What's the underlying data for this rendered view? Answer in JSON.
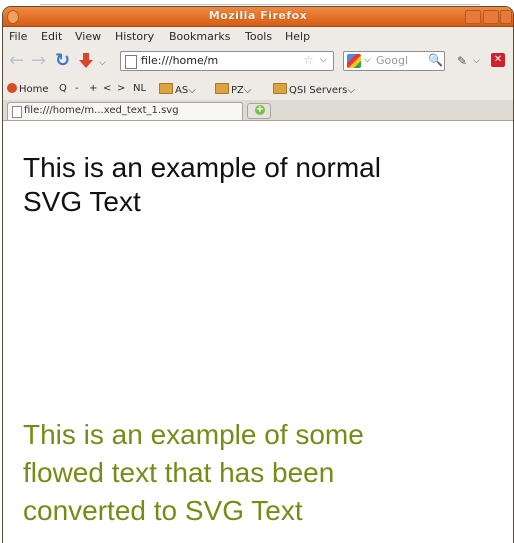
{
  "window": {
    "title": "Mozilla Firefox"
  },
  "menu": [
    "File",
    "Edit",
    "View",
    "History",
    "Bookmarks",
    "Tools",
    "Help"
  ],
  "toolbar": {
    "url": "file:///home/m",
    "search_placeholder": "Googl"
  },
  "bookmarks": [
    {
      "label": "Home",
      "icon": "home-icon"
    },
    {
      "label": "Q",
      "icon": ""
    },
    {
      "label": "-",
      "icon": ""
    },
    {
      "label": "+",
      "icon": ""
    },
    {
      "label": "<",
      "icon": ""
    },
    {
      "label": ">",
      "icon": ""
    },
    {
      "label": "NL",
      "icon": ""
    },
    {
      "label": "AS",
      "icon": "folder-icon"
    },
    {
      "label": "PZ",
      "icon": "folder-icon"
    },
    {
      "label": "QSI Servers",
      "icon": "folder-icon"
    }
  ],
  "tab": {
    "label": "file:///home/m...xed_text_1.svg"
  },
  "content": {
    "normal_text": [
      "This is an example of normal",
      "SVG Text"
    ],
    "flowed_text": [
      "This is an example of some",
      "flowed text that has been",
      "converted to SVG Text"
    ]
  },
  "colors": {
    "titlebar": "#e06c23",
    "flowed_text": "#7a8a18",
    "normal_text": "#111111"
  }
}
